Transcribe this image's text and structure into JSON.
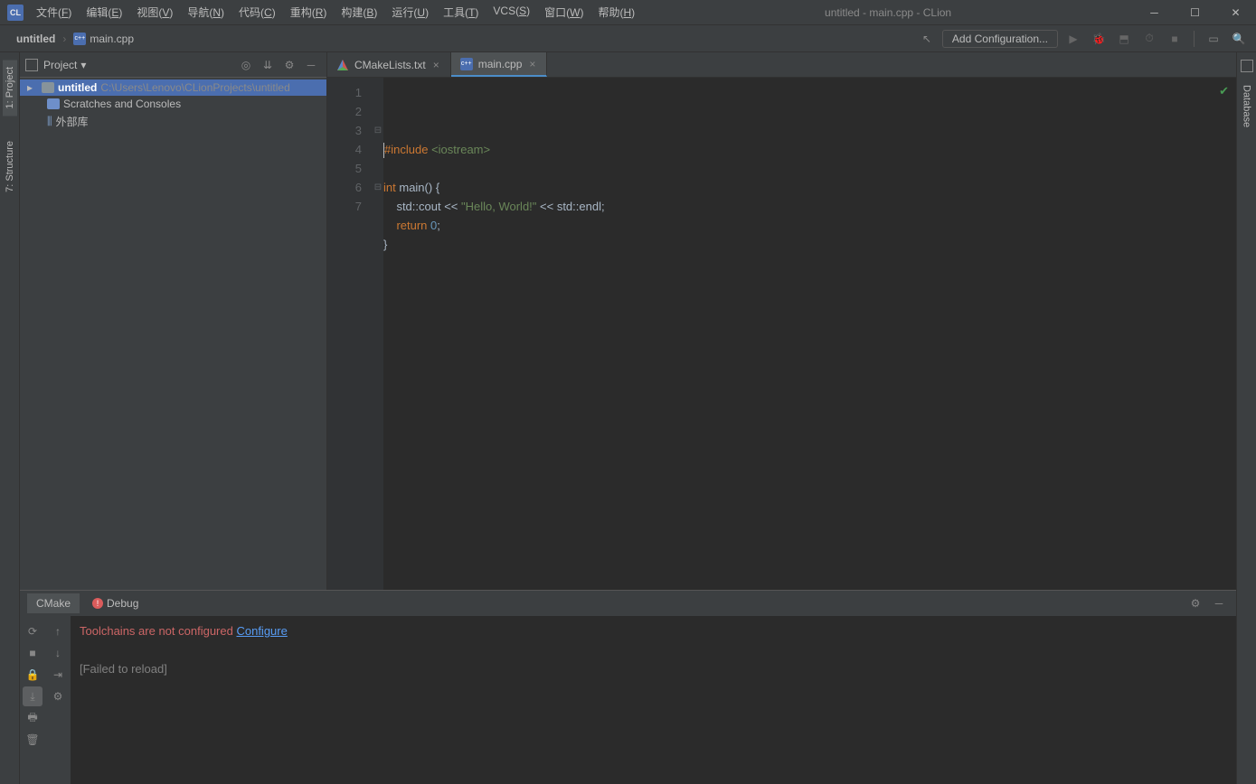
{
  "window": {
    "title": "untitled - main.cpp - CLion"
  },
  "menu": [
    {
      "label": "文件",
      "key": "F"
    },
    {
      "label": "编辑",
      "key": "E"
    },
    {
      "label": "视图",
      "key": "V"
    },
    {
      "label": "导航",
      "key": "N"
    },
    {
      "label": "代码",
      "key": "C"
    },
    {
      "label": "重构",
      "key": "R"
    },
    {
      "label": "构建",
      "key": "B"
    },
    {
      "label": "运行",
      "key": "U"
    },
    {
      "label": "工具",
      "key": "T"
    },
    {
      "label": "VCS",
      "key": "S"
    },
    {
      "label": "窗口",
      "key": "W"
    },
    {
      "label": "帮助",
      "key": "H"
    }
  ],
  "breadcrumb": {
    "project": "untitled",
    "file": "main.cpp"
  },
  "toolbar": {
    "add_config": "Add Configuration..."
  },
  "left_tabs": [
    {
      "label": "1: Project",
      "id": "project",
      "active": true
    },
    {
      "label": "7: Structure",
      "id": "structure",
      "active": false
    }
  ],
  "right_tabs": [
    {
      "label": "Database",
      "id": "database"
    }
  ],
  "project_panel": {
    "title": "Project",
    "tree": [
      {
        "label": "untitled",
        "path": "C:\\Users\\Lenovo\\CLionProjects\\untitled",
        "kind": "root",
        "selected": true,
        "expanded": false,
        "indent": 0
      },
      {
        "label": "Scratches and Consoles",
        "kind": "folder",
        "indent": 1
      },
      {
        "label": "外部库",
        "kind": "libs",
        "indent": 1
      }
    ]
  },
  "tabs": [
    {
      "label": "CMakeLists.txt",
      "icon": "cmake",
      "active": false
    },
    {
      "label": "main.cpp",
      "icon": "cpp",
      "active": true
    }
  ],
  "editor": {
    "lines": [
      {
        "n": 1,
        "html": "<span class='pre'>#include</span> <span class='inc'>&lt;iostream&gt;</span>",
        "fold": ""
      },
      {
        "n": 2,
        "html": "",
        "fold": ""
      },
      {
        "n": 3,
        "html": "<span class='kw'>int</span> <span class='fn'>main</span>() {",
        "fold": "⊟"
      },
      {
        "n": 4,
        "html": "    std::cout &lt;&lt; <span class='str'>\"Hello, World!\"</span> &lt;&lt; std::endl<span class='op'>;</span>",
        "fold": ""
      },
      {
        "n": 5,
        "html": "    <span class='kw'>return</span> <span class='num'>0</span><span class='op'>;</span>",
        "fold": ""
      },
      {
        "n": 6,
        "html": "}",
        "fold": "⊟"
      },
      {
        "n": 7,
        "html": "",
        "fold": ""
      }
    ]
  },
  "bottom_tabs": [
    {
      "label": "CMake",
      "active": true
    },
    {
      "label": "Debug",
      "active": false,
      "err": true
    }
  ],
  "console": {
    "err": "Toolchains are not configured",
    "link": "Configure",
    "failed": "[Failed to reload]"
  }
}
